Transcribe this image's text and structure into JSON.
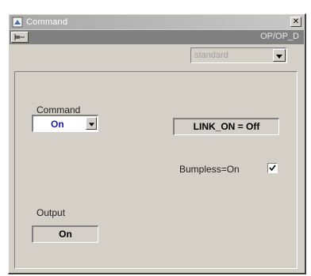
{
  "window": {
    "title": "Command",
    "close_glyph": "✕"
  },
  "header": {
    "tag_name": "OP/OP_D"
  },
  "mode_select": {
    "value": "standard"
  },
  "command": {
    "label": "Command",
    "value": "On"
  },
  "link_status": {
    "text": "LINK_ON = Off"
  },
  "bumpless": {
    "label": "Bumpless=On",
    "checked": true
  },
  "output": {
    "label": "Output",
    "value": "On"
  },
  "icons": {
    "title": "window-app-icon",
    "pin": "pin-icon",
    "dropdown": "chevron-down-icon",
    "check": "check-icon"
  },
  "colors": {
    "command_value": "#1a1ab8",
    "window_bg": "#d4d0c8",
    "header_bg": "#808080"
  }
}
